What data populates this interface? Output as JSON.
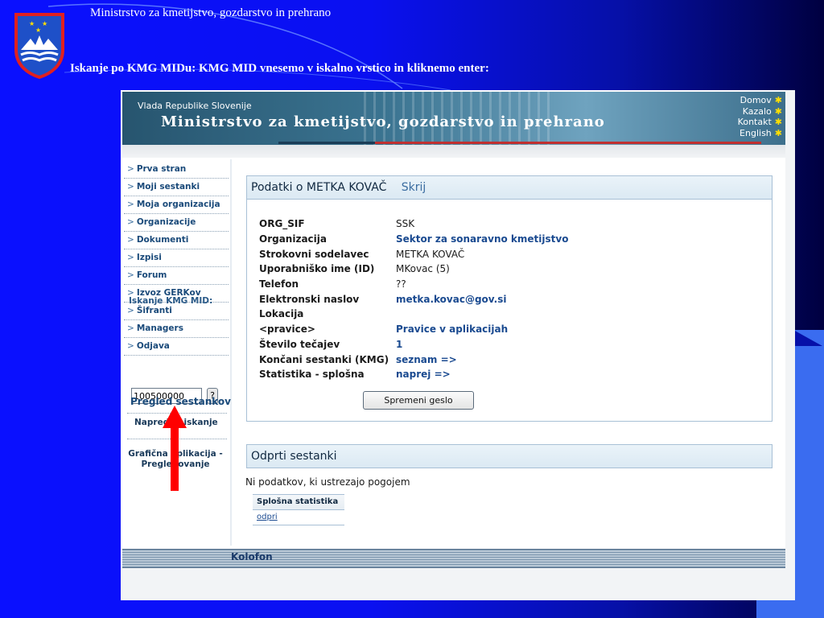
{
  "slide": {
    "title": "Ministrstvo za kmetijstvo, gozdarstvo in prehrano",
    "caption": "Iskanje po KMG MIDu: KMG MID vnesemo v iskalno vrstico in kliknemo enter:"
  },
  "banner": {
    "gov": "Vlada Republike Slovenije",
    "ministry": "Ministrstvo za kmetijstvo, gozdarstvo in prehrano",
    "links": [
      "Domov",
      "Kazalo",
      "Kontakt",
      "English"
    ]
  },
  "nav": {
    "items": [
      "Prva stran",
      "Moji sestanki",
      "Moja organizacija",
      "Organizacije",
      "Dokumenti",
      "Izpisi",
      "Forum",
      "Izvoz GERKov",
      "Šifranti",
      "Managers",
      "Odjava"
    ],
    "kmg_label": "Iskanje KMG MID:",
    "kmg_value": "100500000",
    "kmg_button": "?",
    "advanced": "Napredno iskanje",
    "graphic_line1": "Grafična aplikacija -",
    "graphic_line2": "Pregledovanje"
  },
  "panel": {
    "title": "Podatki o METKA KOVAČ",
    "hide": "Skrij",
    "rows": [
      {
        "k": "ORG_SIF",
        "v": "SSK"
      },
      {
        "k": "Organizacija",
        "v": "Sektor za sonaravno kmetijstvo"
      },
      {
        "k": "Strokovni sodelavec",
        "v": "METKA KOVAČ"
      },
      {
        "k": "Uporabniško ime (ID)",
        "v": "MKovac (5)"
      },
      {
        "k": "Telefon",
        "v": "??"
      },
      {
        "k": "Elektronski naslov",
        "v": "metka.kovac@gov.si"
      },
      {
        "k": "Lokacija",
        "v": ""
      },
      {
        "k": "<pravice>",
        "v": "Pravice v aplikacijah"
      },
      {
        "k": "Število tečajev",
        "v": "1"
      },
      {
        "k": "Končani sestanki (KMG)",
        "v": "seznam =>"
      },
      {
        "k": "Statistika - splošna",
        "v": "naprej =>"
      }
    ],
    "pregled": "Pregled sestankov",
    "change_password": "Spremeni geslo"
  },
  "open_meetings": {
    "title": "Odprti sestanki",
    "empty": "Ni podatkov, ki ustrezajo pogojem",
    "stat_header": "Splošna statistika",
    "stat_link": "odpri"
  },
  "footer": {
    "label": "Kolofon"
  },
  "colors": {
    "slide_bg": "#0a10ff",
    "accent_right": "#3a6cf0",
    "arrow": "#ff0000"
  }
}
